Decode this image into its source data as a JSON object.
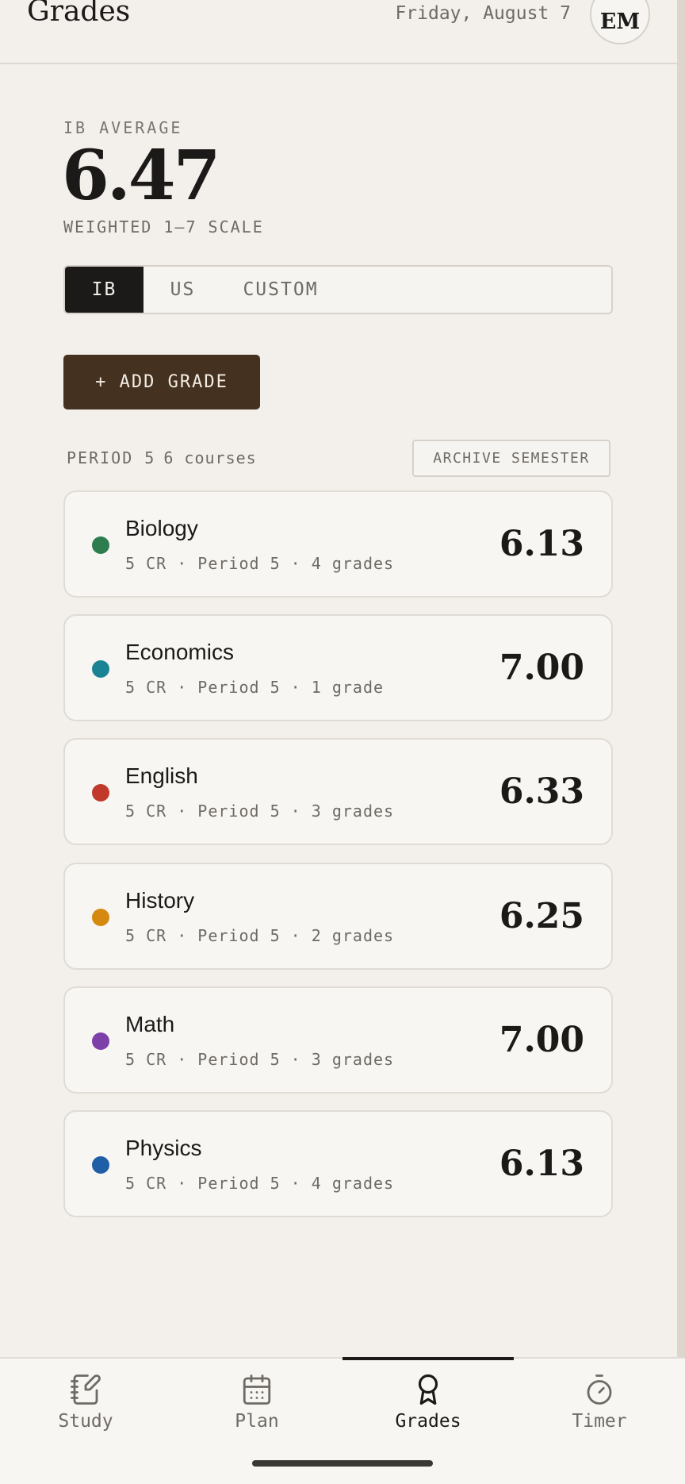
{
  "header": {
    "title": "Grades",
    "date": "Friday, August 7",
    "avatar_initials": "EM"
  },
  "average": {
    "label": "IB AVERAGE",
    "value": "6.47",
    "subtitle": "WEIGHTED 1–7 SCALE"
  },
  "scale_tabs": [
    {
      "label": "IB",
      "selected": true
    },
    {
      "label": "US",
      "selected": false
    },
    {
      "label": "CUSTOM",
      "selected": false
    }
  ],
  "add_grade_label": "+ ADD GRADE",
  "period": {
    "label": "PERIOD 5",
    "count": "6 courses",
    "archive_label": "ARCHIVE SEMESTER"
  },
  "courses": [
    {
      "name": "Biology",
      "meta": "5 CR · Period 5 · 4 grades",
      "grade": "6.13",
      "color": "#2e7d4f"
    },
    {
      "name": "Economics",
      "meta": "5 CR · Period 5 · 1 grade",
      "grade": "7.00",
      "color": "#1a8495"
    },
    {
      "name": "English",
      "meta": "5 CR · Period 5 · 3 grades",
      "grade": "6.33",
      "color": "#c0392b"
    },
    {
      "name": "History",
      "meta": "5 CR · Period 5 · 2 grades",
      "grade": "6.25",
      "color": "#d68910"
    },
    {
      "name": "Math",
      "meta": "5 CR · Period 5 · 3 grades",
      "grade": "7.00",
      "color": "#7d3fa8"
    },
    {
      "name": "Physics",
      "meta": "5 CR · Period 5 · 4 grades",
      "grade": "6.13",
      "color": "#1f5fa8"
    }
  ],
  "nav": [
    {
      "label": "Study",
      "icon": "notebook-pen-icon",
      "active": false
    },
    {
      "label": "Plan",
      "icon": "calendar-icon",
      "active": false
    },
    {
      "label": "Grades",
      "icon": "award-icon",
      "active": true
    },
    {
      "label": "Timer",
      "icon": "stopwatch-icon",
      "active": false
    }
  ],
  "colors": {
    "background": "#f3f0ec",
    "accent_dark": "#1c1a18",
    "add_button": "#45311f"
  }
}
